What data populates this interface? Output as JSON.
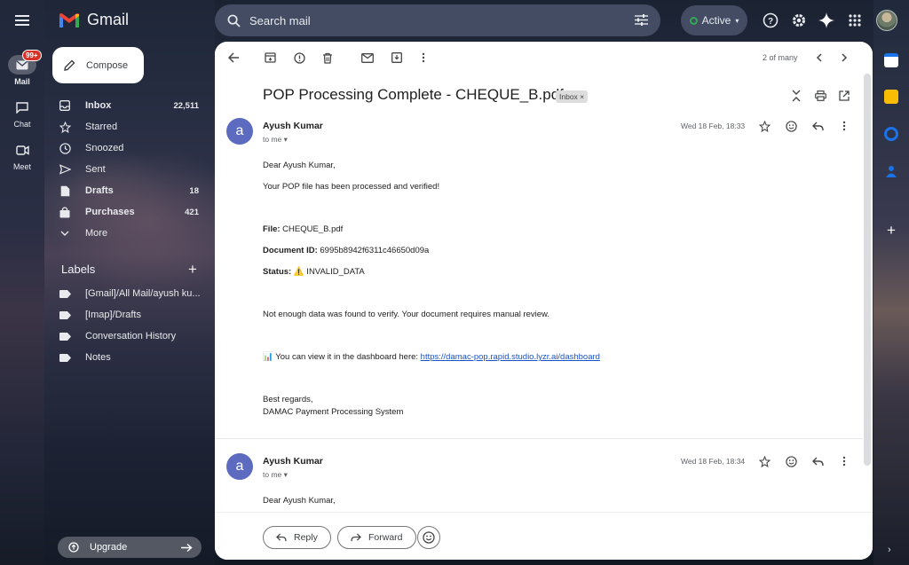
{
  "app": {
    "name": "Gmail"
  },
  "search": {
    "placeholder": "Search mail"
  },
  "status": {
    "label": "Active"
  },
  "rail": [
    {
      "label": "Mail",
      "badge": "99+"
    },
    {
      "label": "Chat"
    },
    {
      "label": "Meet"
    }
  ],
  "compose": {
    "label": "Compose"
  },
  "nav": [
    {
      "label": "Inbox",
      "count": "22,511",
      "icon": "inbox-icon",
      "bold": true
    },
    {
      "label": "Starred",
      "count": "",
      "icon": "star-icon"
    },
    {
      "label": "Snoozed",
      "count": "",
      "icon": "clock-icon"
    },
    {
      "label": "Sent",
      "count": "",
      "icon": "send-icon"
    },
    {
      "label": "Drafts",
      "count": "18",
      "icon": "draft-icon",
      "bold": true
    },
    {
      "label": "Purchases",
      "count": "421",
      "icon": "bag-icon",
      "bold": true
    },
    {
      "label": "More",
      "count": "",
      "icon": "chevron-down-icon"
    }
  ],
  "labels": {
    "title": "Labels",
    "items": [
      "[Gmail]/All Mail/ayush ku...",
      "[Imap]/Drafts",
      "Conversation History",
      "Notes"
    ]
  },
  "upgrade": {
    "label": "Upgrade"
  },
  "pager": {
    "text": "2 of many"
  },
  "thread": {
    "subject": "POP Processing Complete - CHEQUE_B.pdf",
    "chip": "Inbox",
    "chip_close": "×"
  },
  "messages": [
    {
      "avatar": "a",
      "sender": "Ayush Kumar",
      "to": "to me",
      "date": "Wed 18 Feb, 18:33",
      "greeting": "Dear Ayush Kumar,",
      "line1": "Your POP file has been processed and verified!",
      "file_label": "File:",
      "file_value": "CHEQUE_B.pdf",
      "docid_label": "Document ID:",
      "docid_value": "6995b8942f6311c46650d09a",
      "status_label": "Status:",
      "status_value": "⚠️ INVALID_DATA",
      "line2": "Not enough data was found to verify. Your document requires manual review.",
      "dashboard_prefix": "📊 You can view it in the dashboard here:",
      "dashboard_link": "https://damac-pop.rapid.studio.lyzr.ai/dashboard",
      "signoff": "Best regards,",
      "signature": "DAMAC Payment Processing System"
    },
    {
      "avatar": "a",
      "sender": "Ayush Kumar",
      "to": "to me",
      "date": "Wed 18 Feb, 18:34",
      "greeting": "Dear Ayush Kumar,"
    }
  ],
  "actions": {
    "reply": "Reply",
    "forward": "Forward"
  },
  "colors": {
    "accent": "#5c6bc0",
    "link": "#1a55c8",
    "badge": "#d93025",
    "active": "#34a853"
  }
}
